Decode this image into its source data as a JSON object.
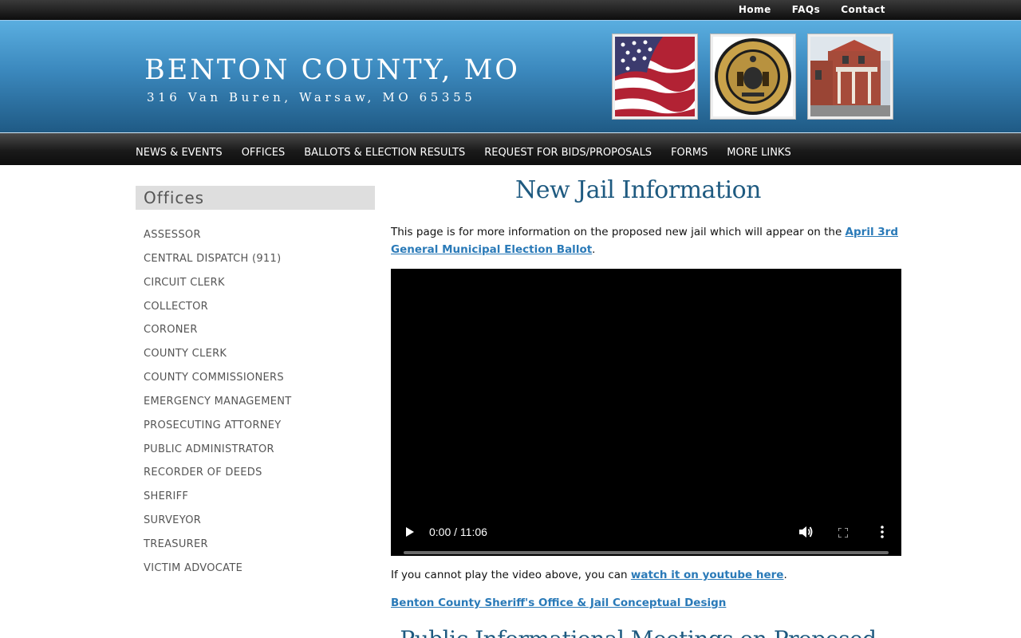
{
  "top_links": [
    "Home",
    "FAQs",
    "Contact"
  ],
  "header": {
    "title": "BENTON COUNTY, MO",
    "address": "316 Van Buren, Warsaw, MO 65355"
  },
  "nav": [
    "NEWS & EVENTS",
    "OFFICES",
    "BALLOTS & ELECTION RESULTS",
    "REQUEST FOR BIDS/PROPOSALS",
    "FORMS",
    "MORE LINKS"
  ],
  "sidebar": {
    "heading": "Offices",
    "items": [
      "ASSESSOR",
      "CENTRAL DISPATCH (911)",
      "CIRCUIT CLERK",
      "COLLECTOR",
      "CORONER",
      "COUNTY CLERK",
      "COUNTY COMMISSIONERS",
      "EMERGENCY MANAGEMENT",
      "PROSECUTING ATTORNEY",
      "PUBLIC ADMINISTRATOR",
      "RECORDER OF DEEDS",
      "SHERIFF",
      "SURVEYOR",
      "TREASURER",
      "VICTIM ADVOCATE"
    ]
  },
  "content": {
    "title": "New Jail Information",
    "intro_text": "This page is for more information on the proposed new jail which will appear on the ",
    "intro_link": "April 3rd General Municipal Election Ballot",
    "intro_end": ".",
    "video": {
      "time": "0:00 / 11:06",
      "progress": 0
    },
    "fallback_text": "If you cannot play the video above, you can ",
    "fallback_link": "watch it on youtube here",
    "fallback_end": ".",
    "design_link": "Benton County Sheriff's Office & Jail Conceptual Design",
    "subheading": "Public Informational Meetings on Proposed"
  },
  "colors": {
    "accent": "#1e5a80",
    "link": "#2a7ab8"
  }
}
